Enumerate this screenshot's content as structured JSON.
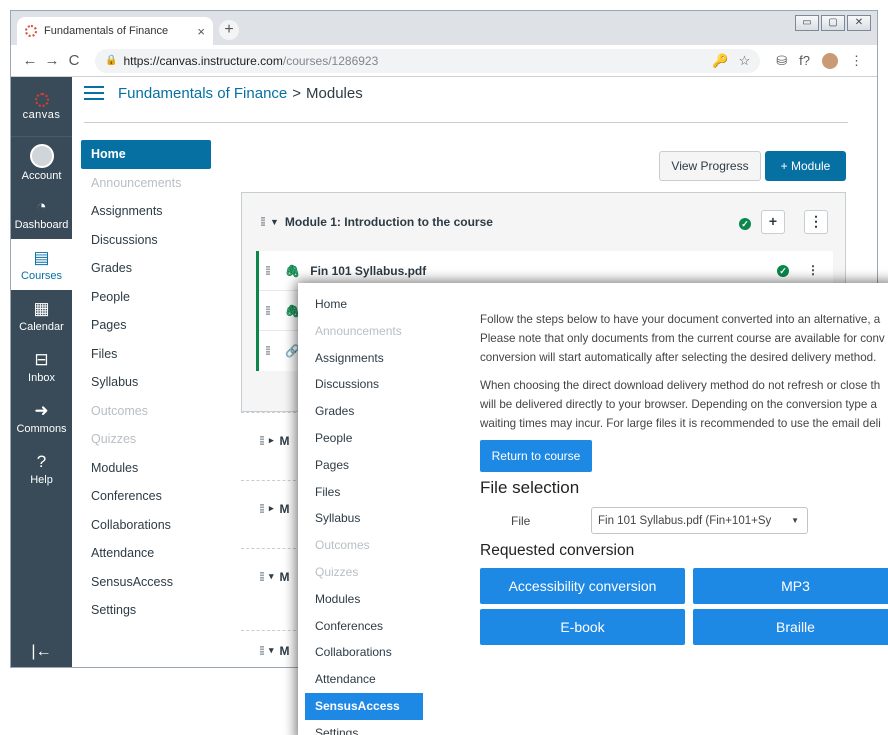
{
  "browser": {
    "tab_title": "Fundamentals of Finance",
    "tab_close": "×",
    "new_tab": "+",
    "url_host": "https://canvas.instructure.com",
    "url_path": "/courses/1286923",
    "window_controls": [
      "▭",
      "▢",
      "✕"
    ],
    "nav": {
      "back": "←",
      "forward": "→",
      "reload": "C"
    },
    "toolbar_icons": [
      "🔑",
      "☆",
      "⛁",
      "f?",
      "⋮"
    ]
  },
  "global_nav": {
    "logo_label": "canvas",
    "items": [
      {
        "label": "Account",
        "icon": "avatar"
      },
      {
        "label": "Dashboard",
        "icon": "gauge-icon",
        "glyph": "◔"
      },
      {
        "label": "Courses",
        "icon": "book-icon",
        "glyph": "▤",
        "active": true
      },
      {
        "label": "Calendar",
        "icon": "calendar-icon",
        "glyph": "▦"
      },
      {
        "label": "Inbox",
        "icon": "inbox-icon",
        "glyph": "⊟"
      },
      {
        "label": "Commons",
        "icon": "commons-icon",
        "glyph": "➜"
      },
      {
        "label": "Help",
        "icon": "help-icon",
        "glyph": "?"
      }
    ],
    "collapse_glyph": "|←"
  },
  "breadcrumb": {
    "course": "Fundamentals of Finance",
    "separator": ">",
    "page": "Modules"
  },
  "course_nav": [
    {
      "label": "Home",
      "state": "active"
    },
    {
      "label": "Announcements",
      "state": "muted"
    },
    {
      "label": "Assignments",
      "state": "normal"
    },
    {
      "label": "Discussions",
      "state": "normal"
    },
    {
      "label": "Grades",
      "state": "normal"
    },
    {
      "label": "People",
      "state": "normal"
    },
    {
      "label": "Pages",
      "state": "normal"
    },
    {
      "label": "Files",
      "state": "normal"
    },
    {
      "label": "Syllabus",
      "state": "normal"
    },
    {
      "label": "Outcomes",
      "state": "muted"
    },
    {
      "label": "Quizzes",
      "state": "muted"
    },
    {
      "label": "Modules",
      "state": "normal"
    },
    {
      "label": "Conferences",
      "state": "normal"
    },
    {
      "label": "Collaborations",
      "state": "normal"
    },
    {
      "label": "Attendance",
      "state": "normal"
    },
    {
      "label": "SensusAccess",
      "state": "normal"
    },
    {
      "label": "Settings",
      "state": "normal"
    }
  ],
  "actions": {
    "view_progress": "View Progress",
    "add_module": "+ Module"
  },
  "module": {
    "title": "Module 1: Introduction to the course",
    "add_glyph": "+",
    "more_glyph": "⋮",
    "check_glyph": "✓",
    "items": [
      {
        "title": "Fin 101 Syllabus.pdf"
      },
      {
        "title": ""
      },
      {
        "title": ""
      }
    ],
    "collapsed_label": "M"
  },
  "overlay": {
    "nav": [
      {
        "label": "Home",
        "state": "normal"
      },
      {
        "label": "Announcements",
        "state": "muted"
      },
      {
        "label": "Assignments",
        "state": "normal"
      },
      {
        "label": "Discussions",
        "state": "normal"
      },
      {
        "label": "Grades",
        "state": "normal"
      },
      {
        "label": "People",
        "state": "normal"
      },
      {
        "label": "Pages",
        "state": "normal"
      },
      {
        "label": "Files",
        "state": "normal"
      },
      {
        "label": "Syllabus",
        "state": "normal"
      },
      {
        "label": "Outcomes",
        "state": "muted"
      },
      {
        "label": "Quizzes",
        "state": "muted"
      },
      {
        "label": "Modules",
        "state": "normal"
      },
      {
        "label": "Conferences",
        "state": "normal"
      },
      {
        "label": "Collaborations",
        "state": "normal"
      },
      {
        "label": "Attendance",
        "state": "normal"
      },
      {
        "label": "SensusAccess",
        "state": "active"
      },
      {
        "label": "Settings",
        "state": "normal"
      }
    ],
    "paragraph1": [
      "Follow the steps below to have your document converted into an alternative, a",
      "Please note that only documents from the current course are available for conv",
      "conversion will start automatically after selecting the desired delivery method."
    ],
    "paragraph2": [
      "When choosing the direct download delivery method do not refresh or close th",
      "will be delivered directly to your browser. Depending on the conversion type a",
      "waiting times may incur. For large files it is recommended to use the email deli"
    ],
    "return_button": "Return to course",
    "file_heading": "File selection",
    "file_label": "File",
    "file_selected": "Fin 101 Syllabus.pdf (Fin+101+Sy",
    "file_caret": "▼",
    "requested_heading": "Requested conversion",
    "conversions": [
      "Accessibility conversion",
      "MP3",
      "E-book",
      "Braille"
    ]
  },
  "colors": {
    "canvas_nav_bg": "#394b58",
    "canvas_blue": "#0770a3",
    "sensus_blue": "#1e88e5",
    "complete_green": "#0b874b"
  }
}
